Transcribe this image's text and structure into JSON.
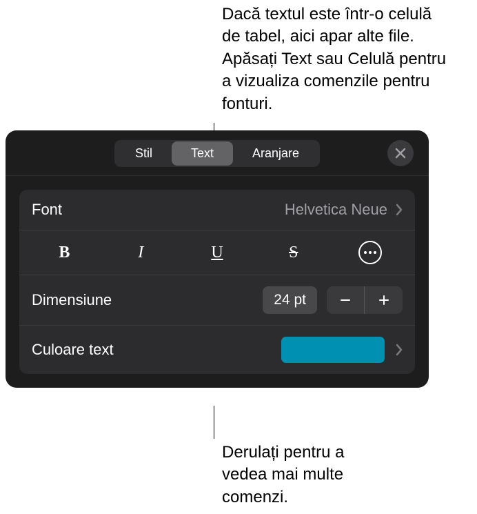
{
  "callouts": {
    "top": "Dacă textul este într-o celulă de tabel, aici apar alte file. Apăsați Text sau Celulă pentru a vizualiza comenzile pentru fonturi.",
    "bottom": "Derulați pentru a vedea mai multe comenzi."
  },
  "tabs": {
    "stil": "Stil",
    "text": "Text",
    "aranjare": "Aranjare"
  },
  "font": {
    "label": "Font",
    "value": "Helvetica Neue"
  },
  "styleButtons": {
    "bold": "B",
    "italic": "I",
    "underline": "U",
    "strike": "S"
  },
  "size": {
    "label": "Dimensiune",
    "value": "24 pt"
  },
  "textColor": {
    "label": "Culoare text",
    "value": "#0091b2"
  }
}
